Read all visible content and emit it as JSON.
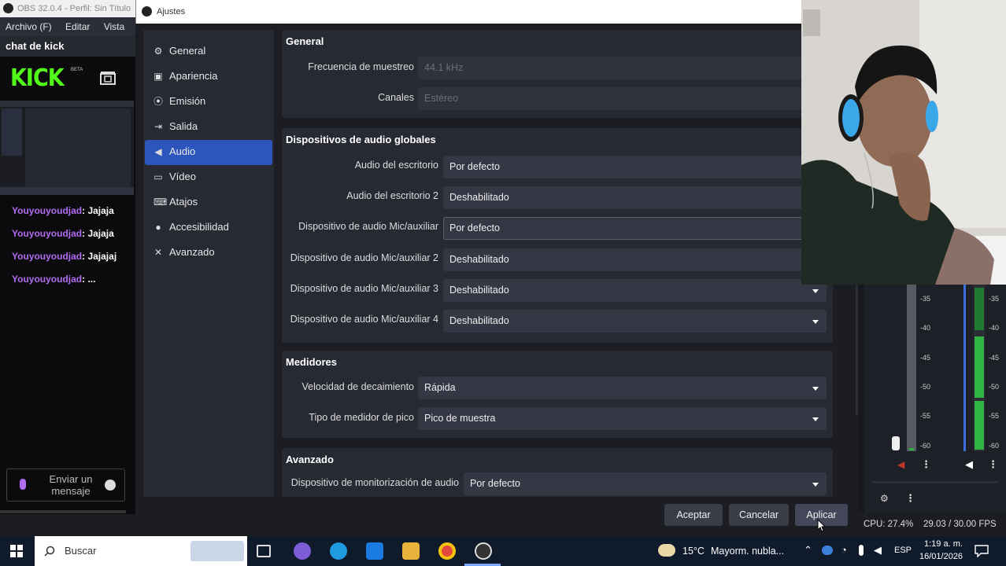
{
  "obs_main": {
    "title": "OBS 32.0.4 - Perfil: Sin Título",
    "menu": [
      "Archivo (F)",
      "Editar",
      "Vista"
    ],
    "chat_panel_title": "chat de kick",
    "kick_logo": "KICK",
    "kick_badge": "BETA",
    "messages": [
      {
        "user": "Youyouyoudjad",
        "text": "Jajaja"
      },
      {
        "user": "Youyouyoudjad",
        "text": "Jajaja"
      },
      {
        "user": "Youyouyoudjad",
        "text": "Jajajaj"
      },
      {
        "user": "Youyouyoudjad",
        "text": "..."
      }
    ],
    "chat_input_placeholder": "Enviar un mensaje"
  },
  "dialog": {
    "title": "Ajustes",
    "nav": [
      {
        "label": "General",
        "icon": "gear-icon",
        "active": false
      },
      {
        "label": "Apariencia",
        "icon": "palette-icon",
        "active": false
      },
      {
        "label": "Emisión",
        "icon": "broadcast-icon",
        "active": false
      },
      {
        "label": "Salida",
        "icon": "output-icon",
        "active": false
      },
      {
        "label": "Audio",
        "icon": "speaker-icon",
        "active": true
      },
      {
        "label": "Vídeo",
        "icon": "monitor-icon",
        "active": false
      },
      {
        "label": "Atajos",
        "icon": "keyboard-icon",
        "active": false
      },
      {
        "label": "Accesibilidad",
        "icon": "accessibility-icon",
        "active": false
      },
      {
        "label": "Avanzado",
        "icon": "tools-icon",
        "active": false
      }
    ],
    "general": {
      "title": "General",
      "sample_rate_label": "Frecuencia de muestreo",
      "sample_rate_value": "44.1 kHz",
      "channels_label": "Canales",
      "channels_value": "Estéreo"
    },
    "global_audio": {
      "title": "Dispositivos de audio globales",
      "rows": [
        {
          "label": "Audio del escritorio",
          "value": "Por defecto"
        },
        {
          "label": "Audio del escritorio 2",
          "value": "Deshabilitado"
        },
        {
          "label": "Dispositivo de audio Mic/auxiliar",
          "value": "Por defecto"
        },
        {
          "label": "Dispositivo de audio Mic/auxiliar 2",
          "value": "Deshabilitado"
        },
        {
          "label": "Dispositivo de audio Mic/auxiliar 3",
          "value": "Deshabilitado"
        },
        {
          "label": "Dispositivo de audio Mic/auxiliar 4",
          "value": "Deshabilitado"
        }
      ]
    },
    "meters": {
      "title": "Medidores",
      "decay_label": "Velocidad de decaimiento",
      "decay_value": "Rápida",
      "peak_label": "Tipo de medidor de pico",
      "peak_value": "Pico de muestra"
    },
    "advanced": {
      "title": "Avanzado",
      "monitor_label": "Dispositivo de monitorización de audio",
      "monitor_value": "Por defecto"
    },
    "buttons": {
      "accept": "Aceptar",
      "cancel": "Cancelar",
      "apply": "Aplicar"
    }
  },
  "mixer": {
    "ticks": [
      "-35",
      "-40",
      "-45",
      "-50",
      "-55",
      "-60"
    ],
    "meter_colors": {
      "green": "#2fb344",
      "blue": "#3b6fe0"
    }
  },
  "stats": {
    "cpu": "CPU: 27.4%",
    "fps": "29.03 / 30.00 FPS"
  },
  "taskbar": {
    "search_placeholder": "Buscar",
    "weather_temp": "15°C",
    "weather_desc": "Mayorm. nubla...",
    "language": "ESP",
    "time": "1:19 a. m.",
    "date": "16/01/2026"
  }
}
